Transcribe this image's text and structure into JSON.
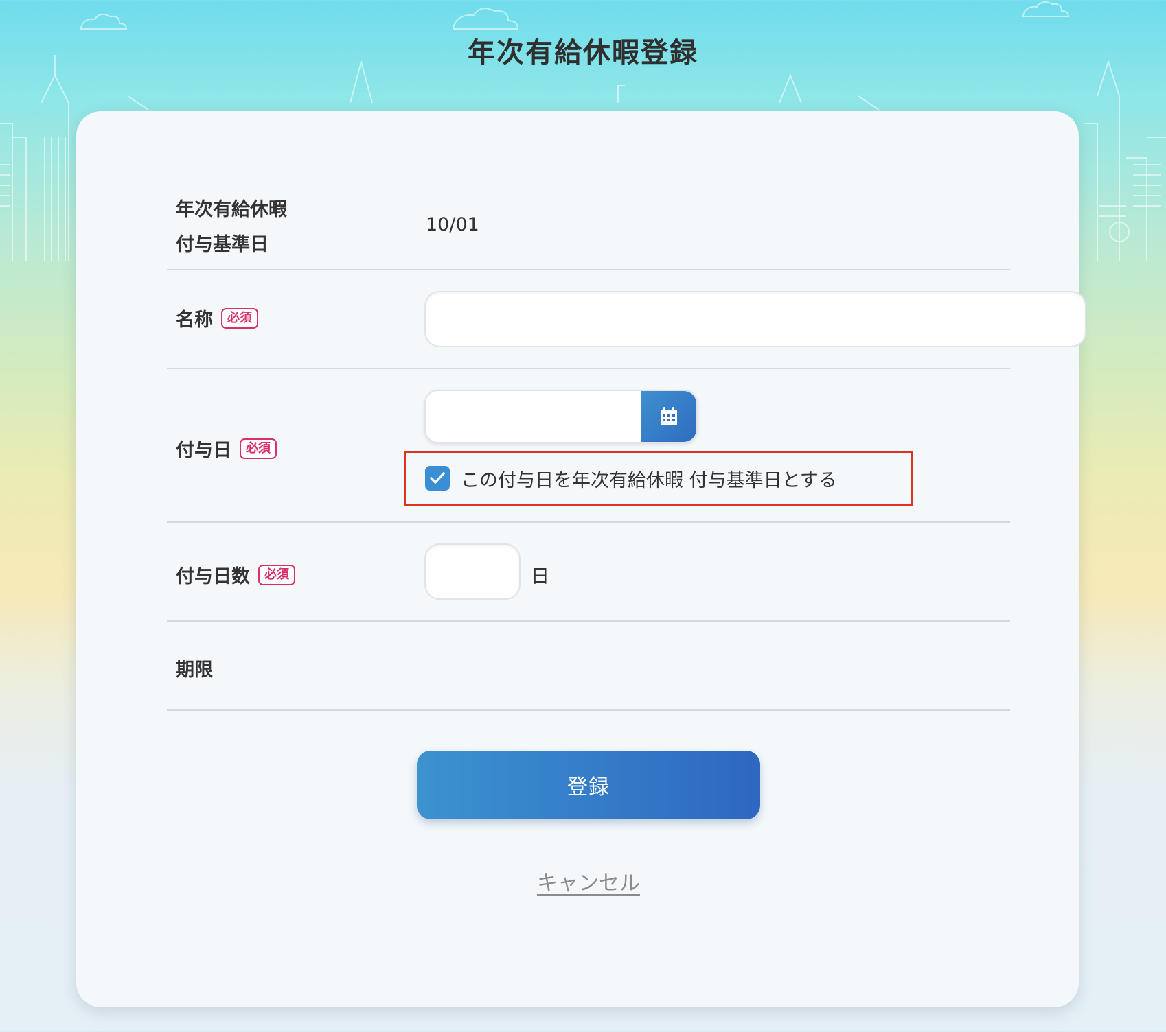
{
  "page": {
    "title": "年次有給休暇登録"
  },
  "form": {
    "base_date": {
      "label_line1": "年次有給休暇",
      "label_line2": "付与基準日",
      "value": "10/01"
    },
    "name": {
      "label": "名称",
      "required_badge": "必須",
      "value": "",
      "placeholder": ""
    },
    "grant_date": {
      "label": "付与日",
      "required_badge": "必須",
      "value": "",
      "calendar_icon": "calendar-icon",
      "checkbox_checked": true,
      "checkbox_label": "この付与日を年次有給休暇 付与基準日とする"
    },
    "grant_days": {
      "label": "付与日数",
      "required_badge": "必須",
      "value": "",
      "unit": "日"
    },
    "expiry": {
      "label": "期限",
      "value": ""
    }
  },
  "actions": {
    "submit_label": "登録",
    "cancel_label": "キャンセル"
  },
  "colors": {
    "accent": "#2e6cc0",
    "required": "#d9306a",
    "highlight": "#e0301e"
  }
}
